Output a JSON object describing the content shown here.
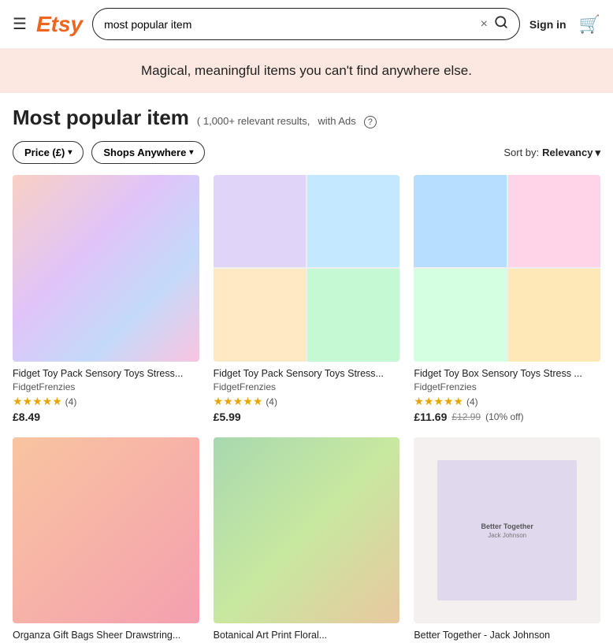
{
  "header": {
    "logo": "Etsy",
    "hamburger_label": "☰",
    "search_value": "most popular item",
    "search_placeholder": "Search for anything",
    "clear_label": "×",
    "search_icon_label": "🔍",
    "sign_in": "Sign in",
    "cart_icon": "🛒"
  },
  "banner": {
    "text": "Magical, meaningful items you can't find anywhere else."
  },
  "page": {
    "title": "Most popular item",
    "result_count": "( 1,000+ relevant results,",
    "ads_label": "with Ads",
    "help_icon": "?"
  },
  "filters": {
    "price_label": "Price (£)",
    "shops_label": "Shops Anywhere",
    "chevron": "▾",
    "sort_label": "Sort by:",
    "sort_value": "Relevancy",
    "sort_chevron": "▾"
  },
  "products": [
    {
      "title": "Fidget Toy Pack Sensory Toys Stress...",
      "shop": "FidgetFrenzies",
      "stars": "★★★★★",
      "review_count": "(4)",
      "price": "£8.49",
      "original_price": "",
      "discount": "",
      "img_type": "1"
    },
    {
      "title": "Fidget Toy Pack Sensory Toys Stress...",
      "shop": "FidgetFrenzies",
      "stars": "★★★★★",
      "review_count": "(4)",
      "price": "£5.99",
      "original_price": "",
      "discount": "",
      "img_type": "2"
    },
    {
      "title": "Fidget Toy Box Sensory Toys Stress ...",
      "shop": "FidgetFrenzies",
      "stars": "★★★★★",
      "review_count": "(4)",
      "price": "£11.69",
      "original_price": "£12.99",
      "discount": "(10% off)",
      "img_type": "3"
    },
    {
      "title": "Organza Gift Bags Sheer Drawstring...",
      "shop": "",
      "stars": "",
      "review_count": "",
      "price": "",
      "original_price": "",
      "discount": "",
      "img_type": "4"
    },
    {
      "title": "Botanical Art Print Floral...",
      "shop": "",
      "stars": "",
      "review_count": "",
      "price": "",
      "original_price": "",
      "discount": "",
      "img_type": "5"
    },
    {
      "title": "Better Together - Jack Johnson",
      "shop": "",
      "stars": "",
      "review_count": "",
      "price": "",
      "original_price": "",
      "discount": "",
      "img_type": "6",
      "album_title": "Better Together",
      "album_subtitle": "Jack Johnson"
    }
  ]
}
